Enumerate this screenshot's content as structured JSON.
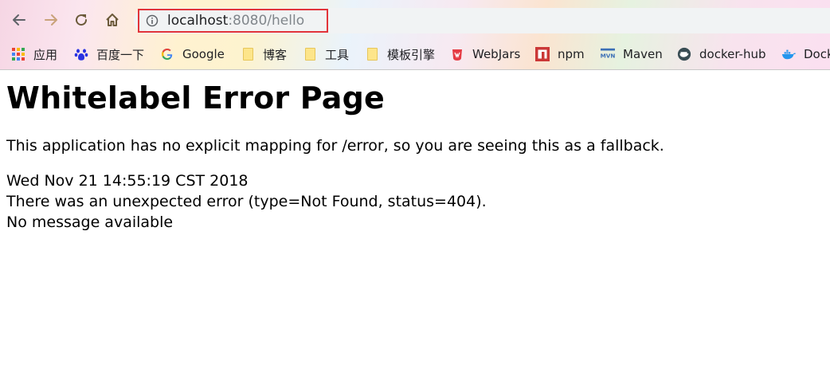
{
  "browser": {
    "url_host": "localhost",
    "url_rest": ":8080/hello",
    "nav": {
      "back_icon": "back-arrow-icon",
      "forward_icon": "forward-arrow-icon",
      "reload_icon": "reload-icon",
      "home_icon": "home-icon",
      "info_icon": "info-icon"
    },
    "bookmarks": [
      {
        "label": "应用",
        "icon": "apps-grid-icon"
      },
      {
        "label": "百度一下",
        "icon": "baidu-paw-icon"
      },
      {
        "label": "Google",
        "icon": "google-g-icon"
      },
      {
        "label": "博客",
        "icon": "folder-icon"
      },
      {
        "label": "工具",
        "icon": "folder-icon"
      },
      {
        "label": "模板引擎",
        "icon": "folder-icon"
      },
      {
        "label": "WebJars",
        "icon": "webjars-icon"
      },
      {
        "label": "npm",
        "icon": "npm-icon"
      },
      {
        "label": "Maven",
        "icon": "maven-icon"
      },
      {
        "label": "docker-hub",
        "icon": "docker-hub-icon"
      },
      {
        "label": "Dock",
        "icon": "docker-whale-icon"
      }
    ]
  },
  "page": {
    "title": "Whitelabel Error Page",
    "message": "This application has no explicit mapping for /error, so you are seeing this as a fallback.",
    "timestamp": "Wed Nov 21 14:55:19 CST 2018",
    "error_line": "There was an unexpected error (type=Not Found, status=404).",
    "detail_line": "No message available"
  }
}
